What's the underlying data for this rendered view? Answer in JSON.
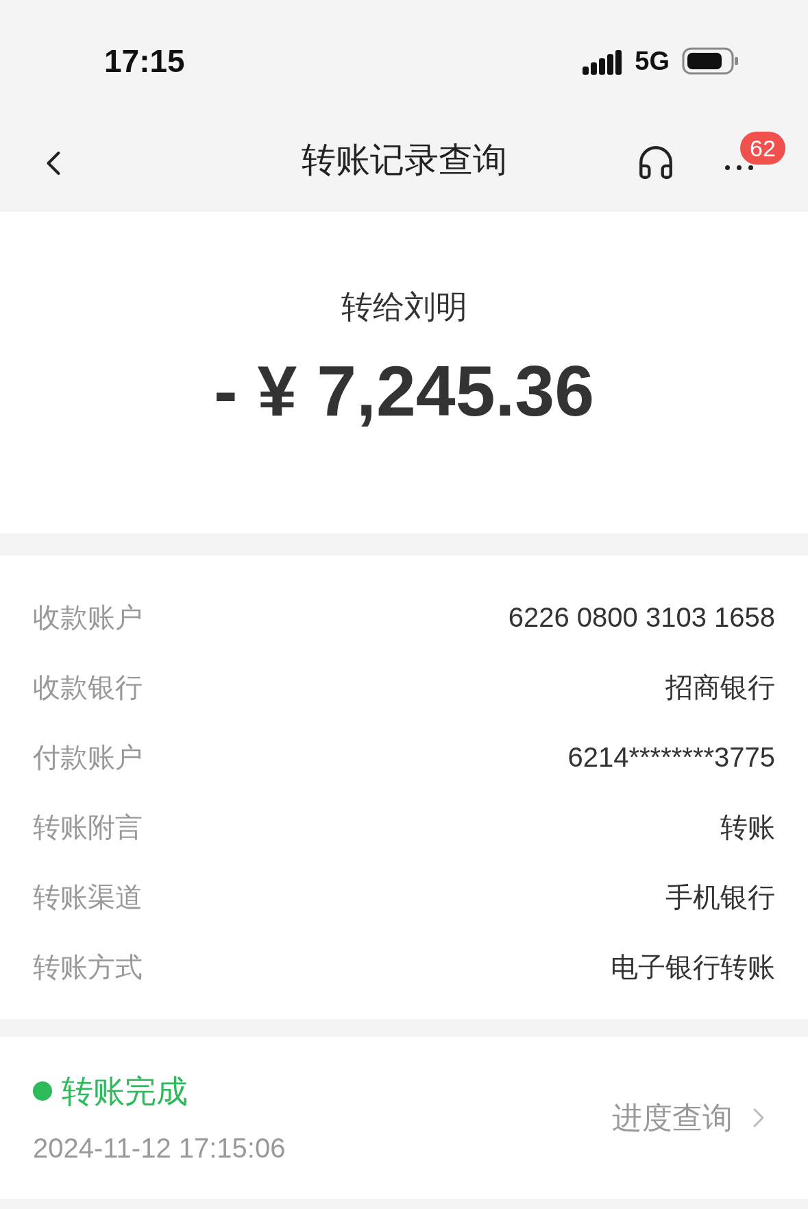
{
  "status_bar": {
    "time": "17:15",
    "network": "5G"
  },
  "nav": {
    "title": "转账记录查询",
    "badge": "62"
  },
  "summary": {
    "payee": "转给刘明",
    "amount": "- ¥ 7,245.36"
  },
  "details": [
    {
      "label": "收款账户",
      "value": "6226 0800 3103 1658"
    },
    {
      "label": "收款银行",
      "value": "招商银行"
    },
    {
      "label": "付款账户",
      "value": "6214********3775"
    },
    {
      "label": "转账附言",
      "value": "转账"
    },
    {
      "label": "转账渠道",
      "value": "手机银行"
    },
    {
      "label": "转账方式",
      "value": "电子银行转账"
    }
  ],
  "status": {
    "text": "转账完成",
    "color": "#2dba5b",
    "time": "2024-11-12 17:15:06",
    "link": "进度查询"
  }
}
